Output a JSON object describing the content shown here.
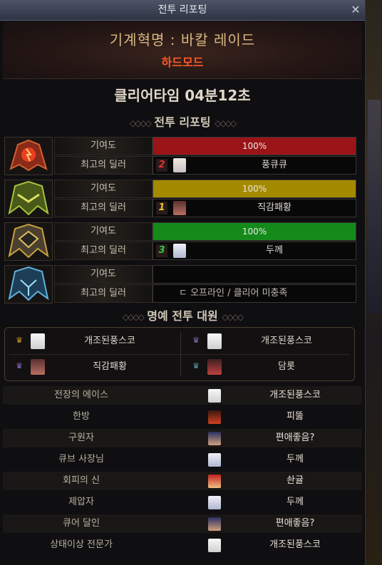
{
  "window": {
    "title": "전투 리포팅",
    "close_icon": "close-icon"
  },
  "header": {
    "raid_name": "기계혁명 : 바칼 레이드",
    "mode": "하드모드",
    "clear_time": "클리어타임   04분12초"
  },
  "section_report": "전투 리포팅",
  "section_honor": "명예 전투 대원",
  "party_rows": [
    {
      "icon": "red-boss-emblem-icon",
      "contribution_label": "기여도",
      "contribution": "100%",
      "bar_fill": 1.0,
      "bar_color": "#9a1418",
      "dealer_label": "최고의 딜러",
      "rank": "2",
      "rank_color": "#e83030",
      "dealer": "풍큐큐"
    },
    {
      "icon": "green-boss-emblem-icon",
      "contribution_label": "기여도",
      "contribution": "100%",
      "bar_fill": 1.0,
      "bar_color": "#a48a00",
      "dealer_label": "최고의 딜러",
      "rank": "1",
      "rank_color": "#e8c820",
      "dealer": "직감패황"
    },
    {
      "icon": "gold-boss-emblem-icon",
      "contribution_label": "기여도",
      "contribution": "100%",
      "bar_fill": 1.0,
      "bar_color": "#148a1a",
      "dealer_label": "최고의 딜러",
      "rank": "3",
      "rank_color": "#30c840",
      "dealer": "두께"
    },
    {
      "icon": "blue-boss-emblem-icon",
      "contribution_label": "기여도",
      "contribution": "",
      "bar_fill": 0,
      "bar_color": "#000000",
      "dealer_label": "최고의 딜러",
      "rank": "",
      "rank_color": "#888888",
      "dealer": "",
      "offline": "ㄷ      오프라인 / 클리어 미충족"
    }
  ],
  "honor_members": [
    {
      "crown_color": "#d8a020",
      "name": "개조된풍스코"
    },
    {
      "crown_color": "#9070c8",
      "name": "개조된풍스코"
    },
    {
      "crown_color": "#9070c8",
      "name": "직감패황"
    },
    {
      "crown_color": "#60a0b0",
      "name": "담롯"
    }
  ],
  "awards": [
    {
      "title": "전장의 에이스",
      "name": "개조된풍스코"
    },
    {
      "title": "한방",
      "name": "피뚫"
    },
    {
      "title": "구원자",
      "name": "편애좋음?"
    },
    {
      "title": "큐브 사장님",
      "name": "두께"
    },
    {
      "title": "회피의 신",
      "name": "솬귤"
    },
    {
      "title": "제압자",
      "name": "두께"
    },
    {
      "title": "큐어 달인",
      "name": "편애좋음?"
    },
    {
      "title": "상태이상 전문가",
      "name": "개조된풍스코"
    }
  ]
}
